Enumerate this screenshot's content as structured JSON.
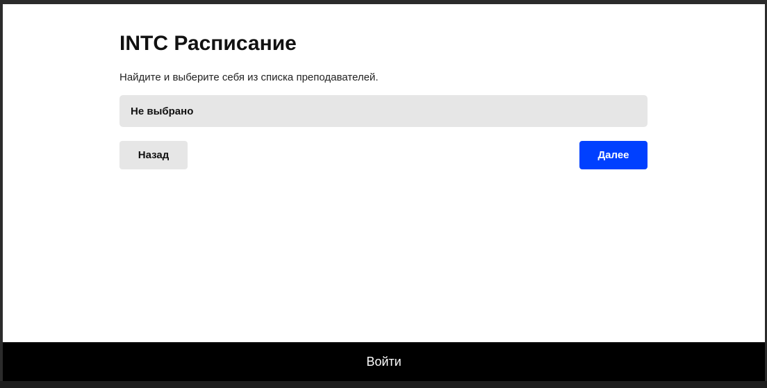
{
  "app": {
    "title": "INTC Расписание",
    "subtitle": "Найдите и выберите себя из списка преподавателей."
  },
  "teacher_select": {
    "value": "Не выбрано"
  },
  "buttons": {
    "back_label": "Назад",
    "next_label": "Далее",
    "login_label": "Войти"
  },
  "colors": {
    "primary": "#0040ff",
    "secondary": "#e6e6e6",
    "footer": "#000000"
  }
}
